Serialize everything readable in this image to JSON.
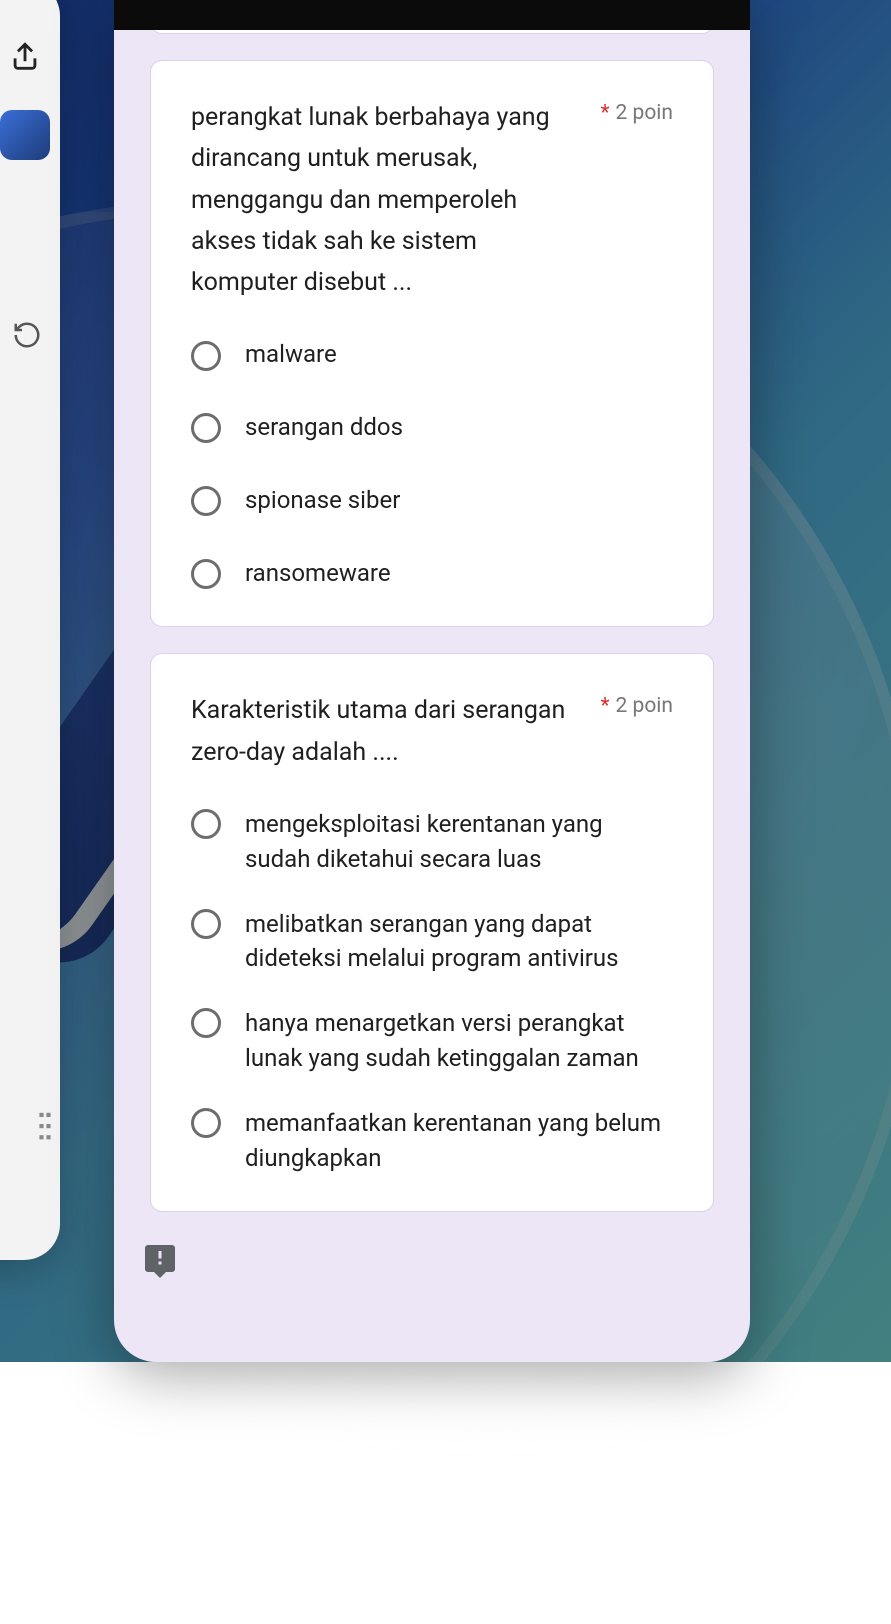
{
  "form": {
    "required_mark": "*",
    "questions": [
      {
        "text": "perangkat lunak berbahaya yang dirancang untuk merusak, menggangu dan memperoleh akses tidak sah ke sistem komputer disebut ...",
        "points": "2 poin",
        "options": [
          "malware",
          "serangan ddos",
          "spionase siber",
          "ransomeware"
        ]
      },
      {
        "text": "Karakteristik utama dari serangan zero-day adalah ....",
        "points": "2 poin",
        "options": [
          "mengeksploitasi kerentanan yang sudah diketahui secara luas",
          "melibatkan serangan yang dapat dideteksi melalui program antivirus",
          "hanya menargetkan versi perangkat lunak yang sudah ketinggalan zaman",
          "memanfaatkan kerentanan yang belum diungkapkan"
        ]
      }
    ]
  },
  "icons": {
    "share": "share-icon",
    "refresh": "refresh-icon",
    "handle": "drag-handle-icon",
    "report": "report-icon"
  }
}
